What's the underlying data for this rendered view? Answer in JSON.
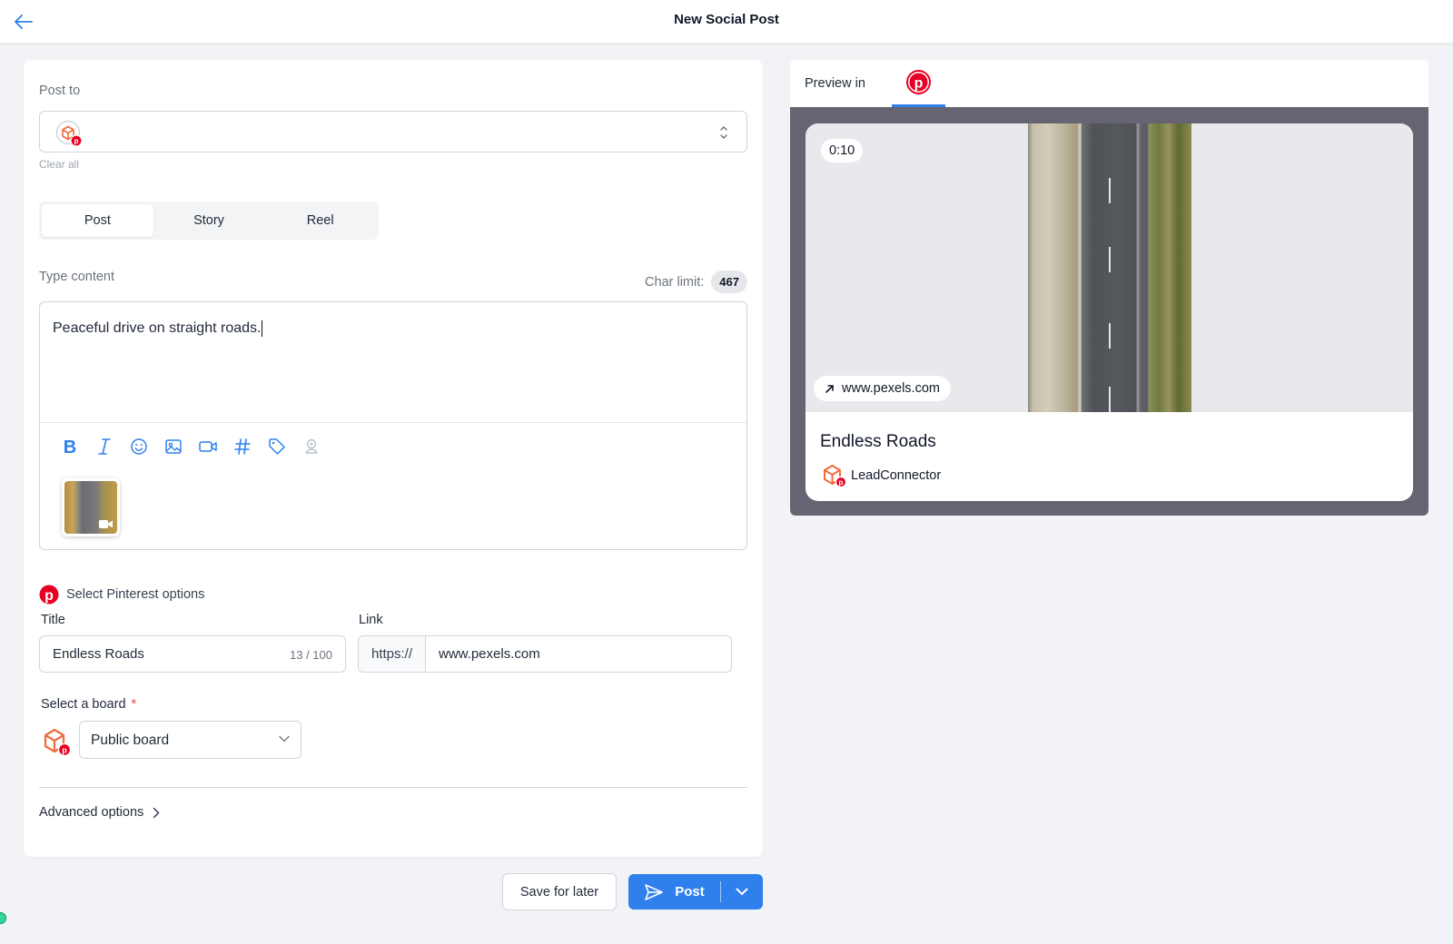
{
  "header": {
    "title": "New Social Post"
  },
  "compose": {
    "post_to_label": "Post to",
    "clear_all": "Clear all",
    "post_types": [
      "Post",
      "Story",
      "Reel"
    ],
    "active_post_type": "Post",
    "content_label": "Type content",
    "char_limit_label": "Char limit:",
    "char_limit_value": "467",
    "content_text": "Peaceful drive on straight roads."
  },
  "pinterest": {
    "heading": "Select Pinterest options",
    "title_label": "Title",
    "title_value": "Endless Roads",
    "title_counter": "13 / 100",
    "link_label": "Link",
    "link_prefix": "https://",
    "link_value": "www.pexels.com",
    "board_label": "Select a board",
    "board_required": "*",
    "board_value": "Public board"
  },
  "advanced": {
    "label": "Advanced options"
  },
  "actions": {
    "save_label": "Save for later",
    "post_label": "Post"
  },
  "preview": {
    "label": "Preview in",
    "duration": "0:10",
    "link": "www.pexels.com",
    "title": "Endless Roads",
    "account": "LeadConnector"
  },
  "colors": {
    "accent": "#2f80ed",
    "pinterest": "#e60023",
    "brand_orange": "#f26b3a"
  },
  "icons": [
    "back-arrow-icon",
    "bold-icon",
    "italic-icon",
    "emoji-icon",
    "image-icon",
    "video-icon",
    "hashtag-icon",
    "tag-icon",
    "location-icon",
    "pinterest-icon",
    "send-icon",
    "chevron-down-icon",
    "chevron-right-icon",
    "external-link-icon"
  ]
}
